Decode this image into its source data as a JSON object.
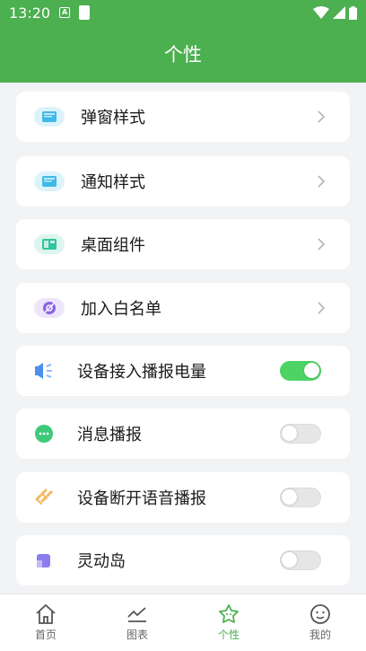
{
  "status_bar": {
    "time": "13:20",
    "notification_letter": "A"
  },
  "header": {
    "title": "个性"
  },
  "settings": [
    {
      "label": "弹窗样式",
      "icon": "popup-window-icon",
      "type": "nav"
    },
    {
      "label": "通知样式",
      "icon": "notification-window-icon",
      "type": "nav"
    },
    {
      "label": "桌面组件",
      "icon": "desktop-widget-icon",
      "type": "nav"
    },
    {
      "label": "加入白名单",
      "icon": "whitelist-icon",
      "type": "nav"
    },
    {
      "label": "设备接入播报电量",
      "icon": "speaker-icon",
      "type": "toggle",
      "enabled": true
    },
    {
      "label": "消息播报",
      "icon": "message-bubble-icon",
      "type": "toggle",
      "enabled": false
    },
    {
      "label": "设备断开语音播报",
      "icon": "link-broken-icon",
      "type": "toggle",
      "enabled": false
    },
    {
      "label": "灵动岛",
      "icon": "dynamic-island-icon",
      "type": "toggle",
      "enabled": false
    }
  ],
  "tabs": [
    {
      "label": "首页",
      "icon": "home-icon",
      "active": false
    },
    {
      "label": "图表",
      "icon": "chart-icon",
      "active": false
    },
    {
      "label": "个性",
      "icon": "personalize-icon",
      "active": true
    },
    {
      "label": "我的",
      "icon": "smiley-face-icon",
      "active": false
    }
  ],
  "colors": {
    "primary": "#4caf50",
    "toggle_on": "#4cd364",
    "background": "#f2f3f5"
  }
}
